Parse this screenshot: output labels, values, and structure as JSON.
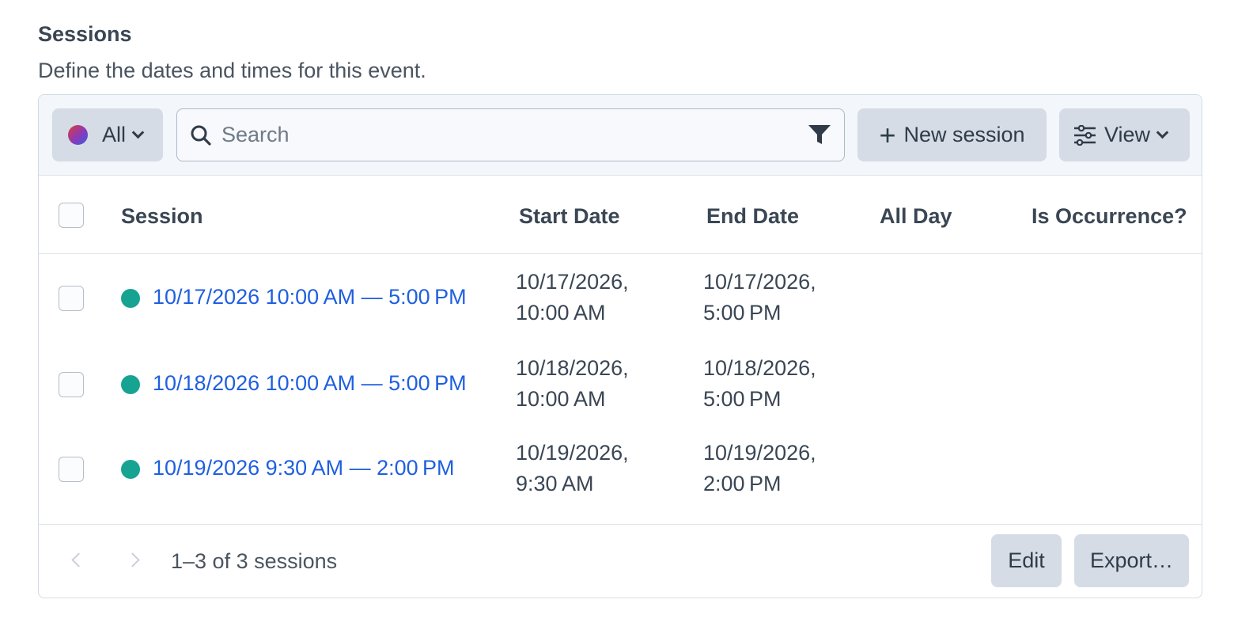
{
  "section": {
    "title": "Sessions",
    "description": "Define the dates and times for this event."
  },
  "toolbar": {
    "filter_label": "All",
    "search_placeholder": "Search",
    "new_label": "New session",
    "view_label": "View"
  },
  "table": {
    "columns": [
      "Session",
      "Start Date",
      "End Date",
      "All Day",
      "Is Occurrence?"
    ],
    "rows": [
      {
        "session": "10/17/2026 10:00 AM — 5:00 PM",
        "start_line1": "10/17/2026,",
        "start_line2": "10:00 AM",
        "end_line1": "10/17/2026,",
        "end_line2": "5:00 PM",
        "all_day": "",
        "is_occurrence": "",
        "status_color": "#17a392"
      },
      {
        "session": "10/18/2026 10:00 AM — 5:00 PM",
        "start_line1": "10/18/2026,",
        "start_line2": "10:00 AM",
        "end_line1": "10/18/2026,",
        "end_line2": "5:00 PM",
        "all_day": "",
        "is_occurrence": "",
        "status_color": "#17a392"
      },
      {
        "session": "10/19/2026 9:30 AM — 2:00 PM",
        "start_line1": "10/19/2026,",
        "start_line2": "9:30 AM",
        "end_line1": "10/19/2026,",
        "end_line2": "2:00 PM",
        "all_day": "",
        "is_occurrence": "",
        "status_color": "#17a392"
      }
    ]
  },
  "footer": {
    "pagination": "1–3 of 3 sessions",
    "edit_label": "Edit",
    "export_label": "Export…"
  },
  "colors": {
    "link": "#1f5fe0",
    "status_active": "#17a392",
    "button_bg": "#d5dce6"
  }
}
